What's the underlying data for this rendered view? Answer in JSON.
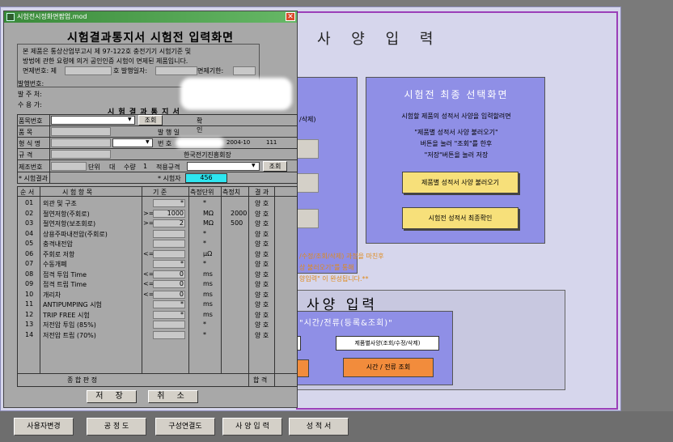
{
  "background": {
    "main_title": "사 양 입 력",
    "final_panel": {
      "title": "시험전 최종 선택화면",
      "line1": "시험할 제품의 성적서 사양을 입력할려면",
      "line2": "\"제품별 성적서 사양 불러오기\"",
      "line3": "버튼을 눌러 \"조회\"를 한후",
      "line4": "\"저장\"버튼을 눌러 저장",
      "btn_load": "제품별 성적서 사양 불러오기",
      "btn_confirm": "시험전 성적서 최종확인"
    },
    "left_panel_text": "/삭제)",
    "orange_notes": [
      "/수정/조회/삭제) 과정을 마친후",
      "상 불러오기\"를 통해",
      "양입력\" 이 완성됩니다.**"
    ],
    "bottom_title": "전 사양 입력",
    "bottom_inner_title": "\"시간/전류(등록&조회)\"",
    "btn_spec": "제품별사양(조회/수정/삭제)",
    "btn_time_current": "시간 / 전류 조회"
  },
  "bottom_bar": {
    "buttons": [
      "사용자변경",
      "공 정 도",
      "구성연결도",
      "사 양 입 력",
      "성 적 서"
    ]
  },
  "dialog": {
    "title": "시험전시정화면팝업.mod",
    "close": "✕",
    "form_title": "시험결과통지서 시험전 입력화면",
    "notice": {
      "line1": "본 제품은 통상산업부고시 제 97-122호 충전기기 시험기준 및",
      "line2": "방법에 관한 요령에 의거 공인인증 시험이 면제된 제품입니다.",
      "exempt_no": "면제번호: 제",
      "issue_date": "호 발행일자:",
      "exempt_period": "면제기한:"
    },
    "issue_no": "발행번호:",
    "issuer": "발 주 처:",
    "recipient": "수 용 가:",
    "notice_title": "시 험 결 과 통 지 서",
    "fields": {
      "product_no": "품목번호",
      "lookup": "조회",
      "confirm": "확 인",
      "product": "품 목",
      "issue_date": "발 행 일",
      "model": "형 식 명",
      "number": "번 호",
      "number_value": "2004-10",
      "number_suffix": "111",
      "spec": "규 격",
      "org": "한국전기진흥회장",
      "mfg_no": "제조번호",
      "unit": "단위",
      "qty_label": "대",
      "qty": "수량",
      "qty_value": "1",
      "std": "적용규격",
      "lookup2": "조회",
      "test_result": "* 시험결과",
      "tester": "* 시험자",
      "tester_value": "456"
    },
    "table_headers": [
      "순 서",
      "시 험 항 목",
      "기 준",
      "측정단위",
      "측정치",
      "결 과"
    ],
    "rows": [
      {
        "no": "01",
        "item": "외관 및 구조",
        "op": "",
        "std": "*",
        "unit": "*",
        "val": "",
        "res": "양 호"
      },
      {
        "no": "02",
        "item": "절연저항(주회로)",
        "op": ">=",
        "std": "1000",
        "unit": "MΩ",
        "val": "2000",
        "res": "양 호"
      },
      {
        "no": "03",
        "item": "절연저항(보조회로)",
        "op": ">=",
        "std": "2",
        "unit": "MΩ",
        "val": "500",
        "res": "양 호"
      },
      {
        "no": "04",
        "item": "상용주파내전압(주회로)",
        "op": "",
        "std": "",
        "unit": "*",
        "val": "",
        "res": "양 호"
      },
      {
        "no": "05",
        "item": "충격내전압",
        "op": "",
        "std": "",
        "unit": "*",
        "val": "",
        "res": "양 호"
      },
      {
        "no": "06",
        "item": "주회로 저항",
        "op": "<=",
        "std": "",
        "unit": "μΩ",
        "val": "",
        "res": "양 호"
      },
      {
        "no": "07",
        "item": "수동개폐",
        "op": "",
        "std": "*",
        "unit": "*",
        "val": "",
        "res": "양 호"
      },
      {
        "no": "08",
        "item": "접격 투입 Time",
        "op": "<=",
        "std": "0",
        "unit": "ms",
        "val": "",
        "res": "양 호"
      },
      {
        "no": "09",
        "item": "접격 트립 Time",
        "op": "<=",
        "std": "0",
        "unit": "ms",
        "val": "",
        "res": "양 호"
      },
      {
        "no": "10",
        "item": "개리차",
        "op": "<=",
        "std": "0",
        "unit": "ms",
        "val": "",
        "res": "양 호"
      },
      {
        "no": "11",
        "item": "ANTIPUMPING 시험",
        "op": "",
        "std": "*",
        "unit": "ms",
        "val": "",
        "res": "양 호"
      },
      {
        "no": "12",
        "item": "TRIP FREE 시험",
        "op": "",
        "std": "*",
        "unit": "ms",
        "val": "",
        "res": "양 호"
      },
      {
        "no": "13",
        "item": "저전압 투입 (85%)",
        "op": "",
        "std": "",
        "unit": "*",
        "val": "",
        "res": "양 호"
      },
      {
        "no": "14",
        "item": "저전압 트립 (70%)",
        "op": "",
        "std": "",
        "unit": "*",
        "val": "",
        "res": "양 호"
      }
    ],
    "total_label": "종 합 판 정",
    "total_result": "합 격",
    "btn_save": "저 장",
    "btn_cancel": "취 소"
  }
}
